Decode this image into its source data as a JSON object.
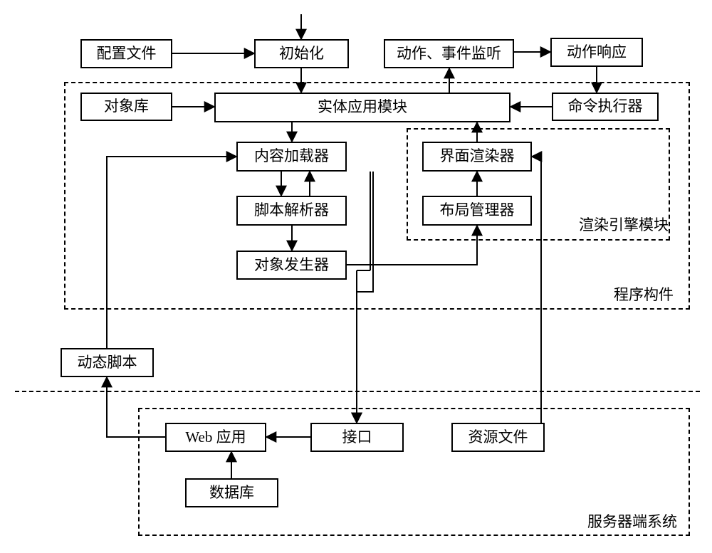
{
  "nodes": {
    "config_file": "配置文件",
    "initialize": "初始化",
    "action_listener": "动作、事件监听",
    "action_response": "动作响应",
    "object_library": "对象库",
    "entity_app_module": "实体应用模块",
    "command_executor": "命令执行器",
    "content_loader": "内容加载器",
    "ui_renderer": "界面渲染器",
    "script_parser": "脚本解析器",
    "layout_manager": "布局管理器",
    "object_generator": "对象发生器",
    "dynamic_script": "动态脚本",
    "web_app": "Web 应用",
    "interface": "接口",
    "resource_file": "资源文件",
    "database": "数据库"
  },
  "groups": {
    "render_engine_module": "渲染引擎模块",
    "program_component": "程序构件",
    "server_side_system": "服务器端系统"
  },
  "chart_data": {
    "type": "flow-diagram",
    "groups": [
      {
        "id": "program_component",
        "label": "程序构件",
        "contains": [
          "object_library",
          "entity_app_module",
          "command_executor",
          "content_loader",
          "script_parser",
          "object_generator",
          "render_engine_module"
        ]
      },
      {
        "id": "render_engine_module",
        "label": "渲染引擎模块",
        "contains": [
          "ui_renderer",
          "layout_manager"
        ],
        "parent": "program_component"
      },
      {
        "id": "server_side_system",
        "label": "服务器端系统",
        "contains": [
          "web_app",
          "interface",
          "resource_file",
          "database"
        ]
      }
    ],
    "nodes": [
      {
        "id": "config_file",
        "label": "配置文件"
      },
      {
        "id": "initialize",
        "label": "初始化"
      },
      {
        "id": "action_listener",
        "label": "动作、事件监听"
      },
      {
        "id": "action_response",
        "label": "动作响应"
      },
      {
        "id": "object_library",
        "label": "对象库"
      },
      {
        "id": "entity_app_module",
        "label": "实体应用模块"
      },
      {
        "id": "command_executor",
        "label": "命令执行器"
      },
      {
        "id": "content_loader",
        "label": "内容加载器"
      },
      {
        "id": "ui_renderer",
        "label": "界面渲染器"
      },
      {
        "id": "script_parser",
        "label": "脚本解析器"
      },
      {
        "id": "layout_manager",
        "label": "布局管理器"
      },
      {
        "id": "object_generator",
        "label": "对象发生器"
      },
      {
        "id": "dynamic_script",
        "label": "动态脚本"
      },
      {
        "id": "web_app",
        "label": "Web 应用"
      },
      {
        "id": "interface",
        "label": "接口"
      },
      {
        "id": "resource_file",
        "label": "资源文件"
      },
      {
        "id": "database",
        "label": "数据库"
      }
    ],
    "edges": [
      {
        "from": "(external-top)",
        "to": "initialize"
      },
      {
        "from": "config_file",
        "to": "initialize"
      },
      {
        "from": "initialize",
        "to": "entity_app_module"
      },
      {
        "from": "object_library",
        "to": "entity_app_module"
      },
      {
        "from": "command_executor",
        "to": "entity_app_module"
      },
      {
        "from": "entity_app_module",
        "to": "action_listener"
      },
      {
        "from": "action_listener",
        "to": "action_response"
      },
      {
        "from": "action_response",
        "to": "command_executor"
      },
      {
        "from": "entity_app_module",
        "to": "content_loader"
      },
      {
        "from": "dynamic_script",
        "to": "content_loader"
      },
      {
        "from": "content_loader",
        "to": "script_parser",
        "bidirectional": true
      },
      {
        "from": "script_parser",
        "to": "object_generator"
      },
      {
        "from": "object_generator",
        "to": "layout_manager"
      },
      {
        "from": "layout_manager",
        "to": "ui_renderer"
      },
      {
        "from": "ui_renderer",
        "to": "entity_app_module"
      },
      {
        "from": "resource_file",
        "to": "ui_renderer"
      },
      {
        "from": "content_loader",
        "to": "interface"
      },
      {
        "from": "interface",
        "to": "web_app"
      },
      {
        "from": "database",
        "to": "web_app"
      },
      {
        "from": "web_app",
        "to": "dynamic_script"
      }
    ]
  }
}
